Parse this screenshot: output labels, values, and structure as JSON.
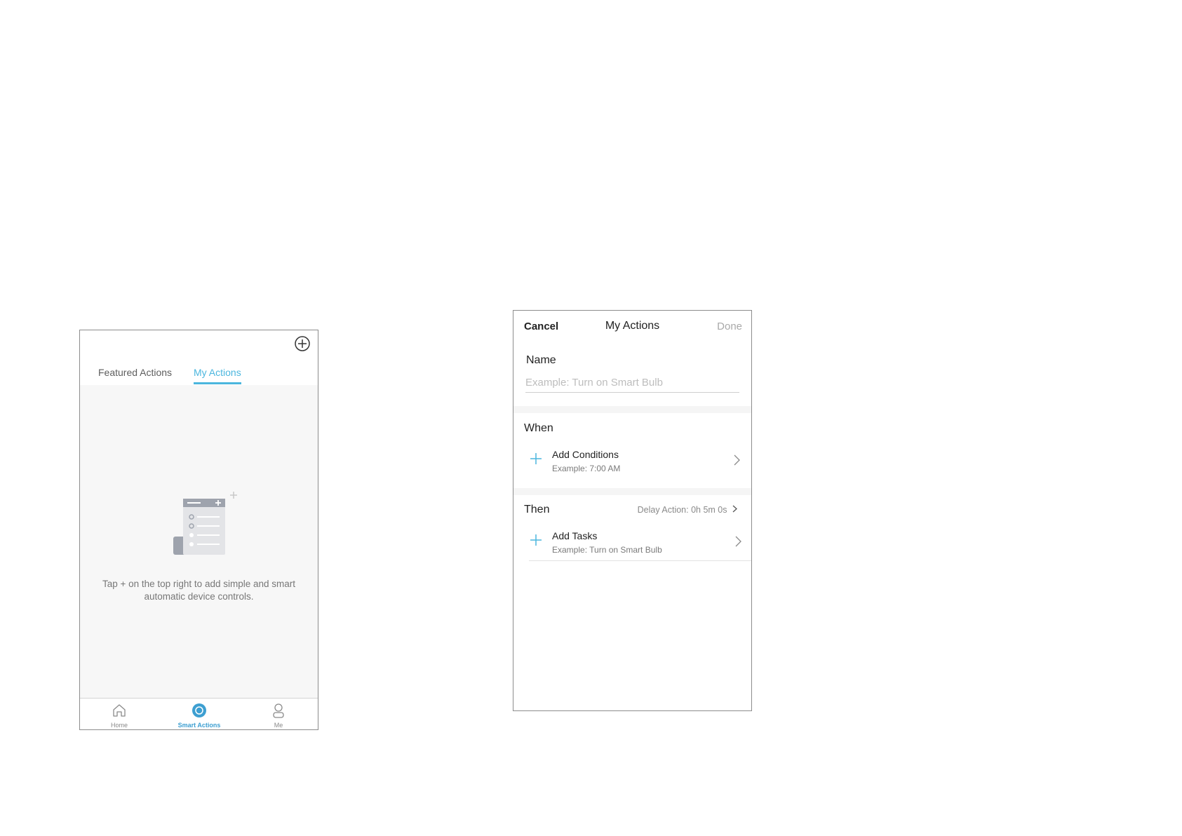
{
  "screen1": {
    "tabs": [
      {
        "label": "Featured Actions",
        "active": false
      },
      {
        "label": "My Actions",
        "active": true
      }
    ],
    "empty_hint": "Tap + on the top right to add simple and smart automatic device controls.",
    "bottom_nav": [
      {
        "label": "Home",
        "icon": "home-icon",
        "active": false
      },
      {
        "label": "Smart Actions",
        "icon": "smart-actions-icon",
        "active": true
      },
      {
        "label": "Me",
        "icon": "person-icon",
        "active": false
      }
    ],
    "add_icon": "plus-circle-icon"
  },
  "screen2": {
    "header": {
      "cancel": "Cancel",
      "title": "My Actions",
      "done": "Done"
    },
    "name": {
      "label": "Name",
      "value": "",
      "placeholder": "Example: Turn on Smart Bulb"
    },
    "when": {
      "label": "When",
      "row_title": "Add Conditions",
      "row_subtitle": "Example: 7:00 AM"
    },
    "then": {
      "label": "Then",
      "delay": "Delay Action: 0h 5m 0s",
      "row_title": "Add Tasks",
      "row_subtitle": "Example: Turn on Smart Bulb"
    }
  },
  "colors": {
    "accent": "#4bb6de",
    "active_nav": "#3d9fd1",
    "muted_text": "#777777",
    "disabled": "#a9a9a9",
    "content_bg": "#f7f7f7"
  }
}
